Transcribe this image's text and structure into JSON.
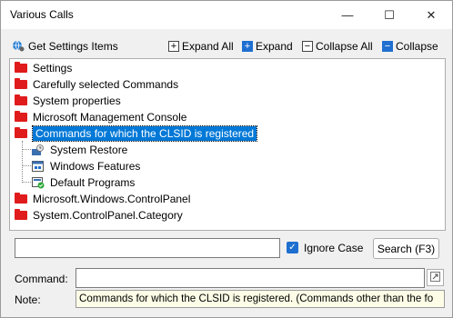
{
  "window": {
    "title": "Various Calls",
    "minimize_glyph": "—",
    "maximize_glyph": "☐",
    "close_glyph": "✕"
  },
  "toolbar": {
    "get_settings_label": "Get Settings Items",
    "expand_all_label": "Expand All",
    "expand_label": "Expand",
    "collapse_all_label": "Collapse All",
    "collapse_label": "Collapse"
  },
  "tree": {
    "items": [
      {
        "label": "Settings",
        "icon": "folder-icon"
      },
      {
        "label": "Carefully selected Commands",
        "icon": "folder-icon"
      },
      {
        "label": "System properties",
        "icon": "folder-icon"
      },
      {
        "label": "Microsoft Management Console",
        "icon": "folder-icon"
      },
      {
        "label": "Commands for which the CLSID is registered",
        "icon": "folder-icon",
        "selected": true
      },
      {
        "label": "System Restore",
        "icon": "system-restore-icon"
      },
      {
        "label": "Windows Features",
        "icon": "windows-features-icon"
      },
      {
        "label": "Default Programs",
        "icon": "default-programs-icon"
      },
      {
        "label": "Microsoft.Windows.ControlPanel",
        "icon": "folder-icon"
      },
      {
        "label": "System.ControlPanel.Category",
        "icon": "folder-icon"
      }
    ]
  },
  "search": {
    "value": "",
    "ignore_case_label": "Ignore Case",
    "ignore_case_checked": true,
    "button_label": "Search (F3)"
  },
  "command": {
    "label": "Command:",
    "value": ""
  },
  "note": {
    "label": "Note:",
    "text": "Commands for which the CLSID is registered.  (Commands other than the fo"
  },
  "colors": {
    "folder": "#e01b1b",
    "selection": "#0078d7",
    "accent": "#1f6fd1"
  }
}
